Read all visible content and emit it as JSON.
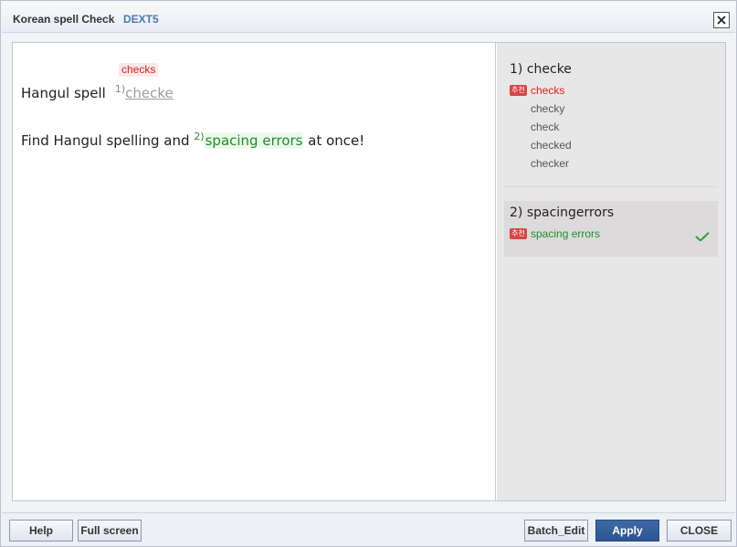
{
  "titlebar": {
    "title": "Korean spell Check",
    "brand": "DEXT5",
    "close_icon": "close-x-icon"
  },
  "editor": {
    "line1": {
      "prefix": "Hangul spell",
      "error_number": "1)",
      "error_word": "checke",
      "suggestion_tag": "checks"
    },
    "line2": {
      "prefix": "Find Hangul spelling and",
      "error_number": "2)",
      "error_word": "spacing errors",
      "suffix": "at once!"
    }
  },
  "sidebar": {
    "item1": {
      "title": "1) checke",
      "badge": "추천",
      "recommended": "checks",
      "alternatives": [
        "checky",
        "check",
        "checked",
        "checker"
      ]
    },
    "item2": {
      "title": "2) spacingerrors",
      "badge": "추천",
      "recommended": "spacing errors",
      "selected_icon": "checkmark-icon"
    }
  },
  "footer": {
    "help": "Help",
    "full_screen": "Full screen",
    "batch_edit": "Batch_Edit",
    "apply": "Apply",
    "close": "CLOSE"
  },
  "colors": {
    "error_red": "#e02020",
    "fixed_green": "#1f8f2a",
    "apply_blue": "#2d5590",
    "badge_red": "#d94545"
  }
}
